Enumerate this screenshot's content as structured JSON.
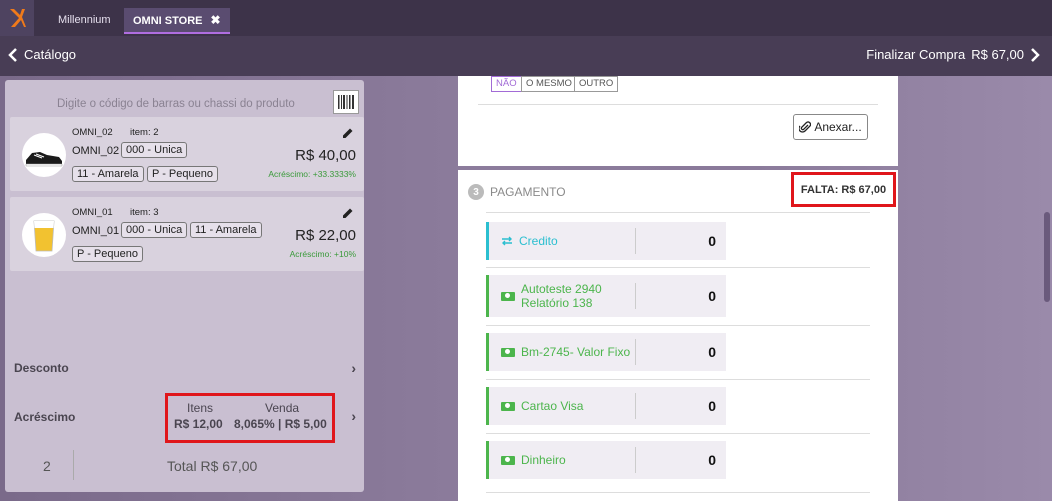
{
  "tabs": [
    {
      "label": "Millennium"
    },
    {
      "label": "OMNI STORE",
      "close": "✖"
    }
  ],
  "navbar": {
    "back_label": "Catálogo",
    "finalize_label": "Finalizar Compra",
    "finalize_amount": "R$ 67,00"
  },
  "search": {
    "placeholder": "Digite o código de barras ou chassi do produto"
  },
  "items": [
    {
      "code": "OMNI_02",
      "item_label": "item: 2",
      "name": "OMNI_02",
      "chip_a": "000 - Unica",
      "chip_b": "11 - Amarela",
      "chip_c": "P - Pequeno",
      "price": "R$ 40,00",
      "acrescimo": "Acréscimo: +33.3333%",
      "icon": "sneaker-icon"
    },
    {
      "code": "OMNI_01",
      "item_label": "item: 3",
      "name": "OMNI_01",
      "chip_a": "000 - Unica",
      "chip_b": "11 - Amarela",
      "chip_c": "P - Pequeno",
      "price": "R$ 22,00",
      "acrescimo": "Acréscimo: +10%",
      "icon": "beer-glass-icon"
    }
  ],
  "summary": {
    "desconto_label": "Desconto",
    "acrescimo_label": "Acréscimo",
    "itens_label": "Itens",
    "venda_label": "Venda",
    "itens_value": "R$ 12,00",
    "venda_value": "8,065% | R$ 5,00",
    "count": "2",
    "total": "Total R$ 67,00"
  },
  "delivery": {
    "options": [
      "NÃO",
      "O MESMO",
      "OUTRO"
    ],
    "selected": "NÃO",
    "attach_label": "Anexar..."
  },
  "payment": {
    "step": "3",
    "title": "PAGAMENTO",
    "falta": "FALTA: R$ 67,00",
    "methods": [
      {
        "label": "Credito",
        "line2": "",
        "value": "0",
        "color": "#2bbfd0",
        "icon": "transfer-icon"
      },
      {
        "label": "Autoteste 2940",
        "line2": "Relatório 138",
        "value": "0",
        "color": "#4cb54c",
        "icon": "money-icon"
      },
      {
        "label": "Bm-2745- Valor Fixo",
        "line2": "",
        "value": "0",
        "color": "#4cb54c",
        "icon": "money-icon"
      },
      {
        "label": "Cartao Visa",
        "line2": "",
        "value": "0",
        "color": "#4cb54c",
        "icon": "money-icon"
      },
      {
        "label": "Dinheiro",
        "line2": "",
        "value": "0",
        "color": "#4cb54c",
        "icon": "money-icon"
      }
    ]
  },
  "colors": {
    "topbar": "#3d3349",
    "navbar": "#483d55",
    "accent": "#b06ee0",
    "highlight": "#e0161b"
  }
}
